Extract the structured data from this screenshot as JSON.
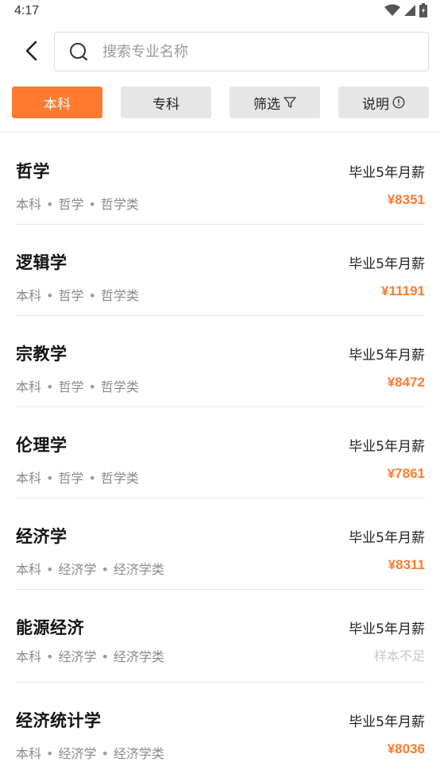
{
  "status_bar": {
    "time": "4:17",
    "icons": [
      "wifi-icon",
      "signal-icon",
      "battery-icon"
    ]
  },
  "header": {
    "back_icon": "chevron-left-icon",
    "search_placeholder": "搜索专业名称"
  },
  "tabs": [
    {
      "label": "本科",
      "active": true
    },
    {
      "label": "专科",
      "active": false
    },
    {
      "label": "筛选",
      "active": false,
      "icon": "filter-icon"
    },
    {
      "label": "说明",
      "active": false,
      "icon": "info-icon"
    }
  ],
  "colors": {
    "accent": "#ff7a2f",
    "tab_inactive": "#e6e6e6",
    "muted_text": "#8a8a8a"
  },
  "majors": [
    {
      "name": "哲学",
      "level": "本科",
      "discipline": "哲学",
      "category": "哲学类",
      "salary_label": "毕业5年月薪",
      "salary": "¥8351"
    },
    {
      "name": "逻辑学",
      "level": "本科",
      "discipline": "哲学",
      "category": "哲学类",
      "salary_label": "毕业5年月薪",
      "salary": "¥11191"
    },
    {
      "name": "宗教学",
      "level": "本科",
      "discipline": "哲学",
      "category": "哲学类",
      "salary_label": "毕业5年月薪",
      "salary": "¥8472"
    },
    {
      "name": "伦理学",
      "level": "本科",
      "discipline": "哲学",
      "category": "哲学类",
      "salary_label": "毕业5年月薪",
      "salary": "¥7861"
    },
    {
      "name": "经济学",
      "level": "本科",
      "discipline": "经济学",
      "category": "经济学类",
      "salary_label": "毕业5年月薪",
      "salary": "¥8311"
    },
    {
      "name": "能源经济",
      "level": "本科",
      "discipline": "经济学",
      "category": "经济学类",
      "salary_label": "毕业5年月薪",
      "salary": "样本不足"
    },
    {
      "name": "经济统计学",
      "level": "本科",
      "discipline": "经济学",
      "category": "经济学类",
      "salary_label": "毕业5年月薪",
      "salary": "¥8036"
    }
  ]
}
